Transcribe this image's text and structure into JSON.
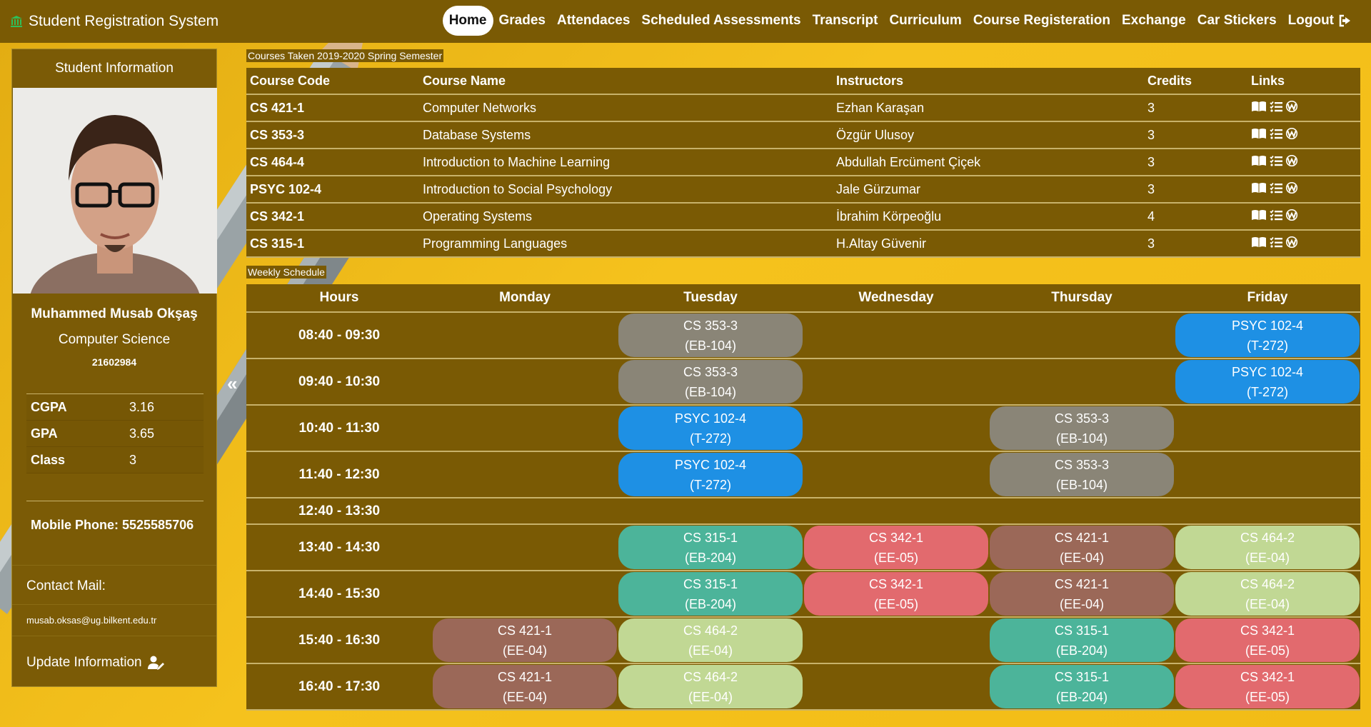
{
  "navbar": {
    "brand": "Student Registration System",
    "links": [
      {
        "label": "Home",
        "active": true
      },
      {
        "label": "Grades"
      },
      {
        "label": "Attendaces"
      },
      {
        "label": "Scheduled Assessments"
      },
      {
        "label": "Transcript"
      },
      {
        "label": "Curriculum"
      },
      {
        "label": "Course Registeration"
      },
      {
        "label": "Exchange"
      },
      {
        "label": "Car Stickers"
      },
      {
        "label": "Logout"
      }
    ]
  },
  "sidebar": {
    "title": "Student Information",
    "name": "Muhammed Musab Okşaş",
    "department": "Computer Science",
    "student_id": "21602984",
    "stats": [
      {
        "label": "CGPA",
        "value": "3.16"
      },
      {
        "label": "GPA",
        "value": "3.65"
      },
      {
        "label": "Class",
        "value": "3"
      }
    ],
    "phone_label": "Mobile Phone:",
    "phone_value": "5525585706",
    "contact_label": "Contact Mail:",
    "contact_mail": "musab.oksas@ug.bilkent.edu.tr",
    "update_label": "Update Information",
    "collapse_glyph": "«"
  },
  "courses": {
    "caption": "Courses Taken 2019-2020 Spring Semester",
    "headers": [
      "Course Code",
      "Course Name",
      "Instructors",
      "Credits",
      "Links"
    ],
    "rows": [
      {
        "code": "CS 421-1",
        "name": "Computer Networks",
        "instructor": "Ezhan Karaşan",
        "credits": "3"
      },
      {
        "code": "CS 353-3",
        "name": "Database Systems",
        "instructor": "Özgür Ulusoy",
        "credits": "3"
      },
      {
        "code": "CS 464-4",
        "name": "Introduction to Machine Learning",
        "instructor": "Abdullah Ercüment Çiçek",
        "credits": "3"
      },
      {
        "code": "PSYC 102-4",
        "name": "Introduction to Social Psychology",
        "instructor": "Jale Gürzumar",
        "credits": "3"
      },
      {
        "code": "CS 342-1",
        "name": "Operating Systems",
        "instructor": "İbrahim Körpeoğlu",
        "credits": "4"
      },
      {
        "code": "CS 315-1",
        "name": "Programming Languages",
        "instructor": "H.Altay Güvenir",
        "credits": "3"
      }
    ],
    "link_icons": [
      "book-icon",
      "list-check-icon",
      "w-icon"
    ]
  },
  "schedule": {
    "caption": "Weekly Schedule",
    "headers": [
      "Hours",
      "Monday",
      "Tuesday",
      "Wednesday",
      "Thursday",
      "Friday"
    ],
    "rows": [
      {
        "hour": "08:40 - 09:30",
        "cells": [
          null,
          {
            "c": "CS 353-3",
            "r": "(EB-104)",
            "k": "db"
          },
          null,
          null,
          {
            "c": "PSYC 102-4",
            "r": "(T-272)",
            "k": "psyc"
          }
        ]
      },
      {
        "hour": "09:40 - 10:30",
        "cells": [
          null,
          {
            "c": "CS 353-3",
            "r": "(EB-104)",
            "k": "db"
          },
          null,
          null,
          {
            "c": "PSYC 102-4",
            "r": "(T-272)",
            "k": "psyc"
          }
        ]
      },
      {
        "hour": "10:40 - 11:30",
        "cells": [
          null,
          {
            "c": "PSYC 102-4",
            "r": "(T-272)",
            "k": "psyc"
          },
          null,
          {
            "c": "CS 353-3",
            "r": "(EB-104)",
            "k": "db"
          },
          null
        ]
      },
      {
        "hour": "11:40 - 12:30",
        "cells": [
          null,
          {
            "c": "PSYC 102-4",
            "r": "(T-272)",
            "k": "psyc"
          },
          null,
          {
            "c": "CS 353-3",
            "r": "(EB-104)",
            "k": "db"
          },
          null
        ]
      },
      {
        "hour": "12:40 - 13:30",
        "lunch": true,
        "cells": [
          null,
          null,
          null,
          null,
          null
        ]
      },
      {
        "hour": "13:40 - 14:30",
        "cells": [
          null,
          {
            "c": "CS 315-1",
            "r": "(EB-204)",
            "k": "315"
          },
          {
            "c": "CS 342-1",
            "r": "(EE-05)",
            "k": "342"
          },
          {
            "c": "CS 421-1",
            "r": "(EE-04)",
            "k": "421"
          },
          {
            "c": "CS 464-2",
            "r": "(EE-04)",
            "k": "464"
          }
        ]
      },
      {
        "hour": "14:40 - 15:30",
        "cells": [
          null,
          {
            "c": "CS 315-1",
            "r": "(EB-204)",
            "k": "315"
          },
          {
            "c": "CS 342-1",
            "r": "(EE-05)",
            "k": "342"
          },
          {
            "c": "CS 421-1",
            "r": "(EE-04)",
            "k": "421"
          },
          {
            "c": "CS 464-2",
            "r": "(EE-04)",
            "k": "464"
          }
        ]
      },
      {
        "hour": "15:40 - 16:30",
        "cells": [
          {
            "c": "CS 421-1",
            "r": "(EE-04)",
            "k": "421"
          },
          {
            "c": "CS 464-2",
            "r": "(EE-04)",
            "k": "464"
          },
          null,
          {
            "c": "CS 315-1",
            "r": "(EB-204)",
            "k": "315"
          },
          {
            "c": "CS 342-1",
            "r": "(EE-05)",
            "k": "342"
          }
        ]
      },
      {
        "hour": "16:40 - 17:30",
        "cells": [
          {
            "c": "CS 421-1",
            "r": "(EE-04)",
            "k": "421"
          },
          {
            "c": "CS 464-2",
            "r": "(EE-04)",
            "k": "464"
          },
          null,
          {
            "c": "CS 315-1",
            "r": "(EB-204)",
            "k": "315"
          },
          {
            "c": "CS 342-1",
            "r": "(EE-05)",
            "k": "342"
          }
        ]
      }
    ]
  },
  "colors": {
    "panel": "#7a5a04",
    "background": "#f2bc16",
    "cs353": "#8a8577",
    "psyc102": "#1e90e4",
    "cs315": "#4cb49a",
    "cs342": "#e26a6e",
    "cs421": "#9b6858",
    "cs464": "#c1d894"
  }
}
